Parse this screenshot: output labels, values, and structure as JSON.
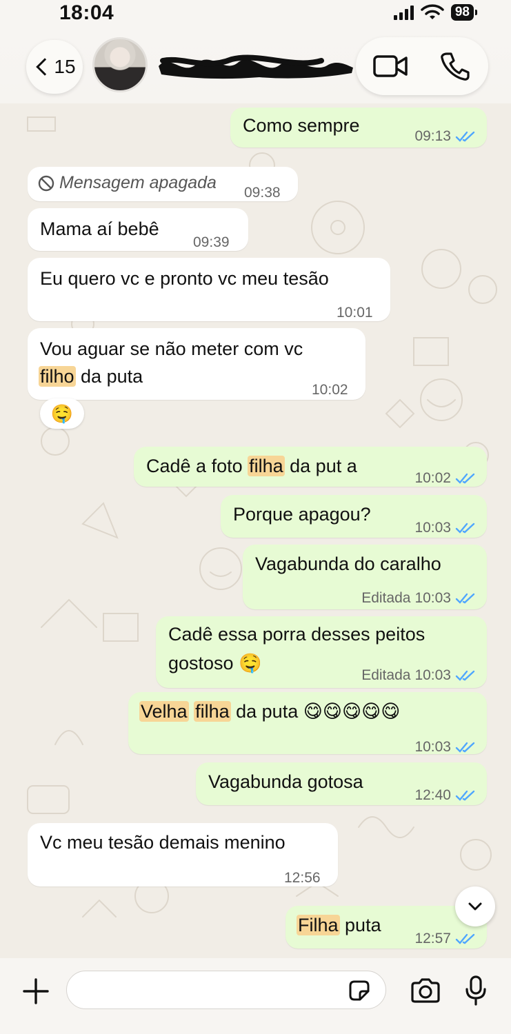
{
  "status_bar": {
    "time": "18:04",
    "battery": "98"
  },
  "header": {
    "back_count": "15",
    "contact_name": ""
  },
  "messages": [
    {
      "text": "Como sempre",
      "time": "09:13"
    },
    {
      "text": "Mensagem apagada",
      "time": "09:38"
    },
    {
      "text": "Mama aí bebê",
      "time": "09:39"
    },
    {
      "text": "Eu quero vc e pronto vc meu tesão",
      "time": "10:01"
    },
    {
      "line1": "Vou aguar se não meter com vc",
      "hl1": "filho",
      "rest": " da puta",
      "time": "10:02",
      "reaction": "🤤"
    },
    {
      "pre": "Cadê a foto ",
      "hl1": "filha",
      "post": " da put a",
      "time": "10:02"
    },
    {
      "text": "Porque apagou?",
      "time": "10:03"
    },
    {
      "text": "Vagabunda do caralho",
      "edited": "Editada",
      "time": "10:03"
    },
    {
      "line1": "Cadê essa porra desses peitos",
      "line2": "gostoso 🤤",
      "edited": "Editada",
      "time": "10:03"
    },
    {
      "hl1": "Velha",
      "hl2": "filha",
      "post": " da puta 😋😋😋😋😋",
      "time": "10:03"
    },
    {
      "text": "Vagabunda gotosa",
      "time": "12:40"
    },
    {
      "text": "Vc meu tesão demais menino",
      "time": "12:56"
    },
    {
      "hl1": "Filha",
      "post": " puta",
      "time": "12:57"
    }
  ],
  "composer": {
    "value": ""
  },
  "colors": {
    "incoming": "#ffffff",
    "outgoing": "#e7fbd4",
    "read_ticks": "#4fa6ff",
    "highlight": "#f7d596"
  }
}
